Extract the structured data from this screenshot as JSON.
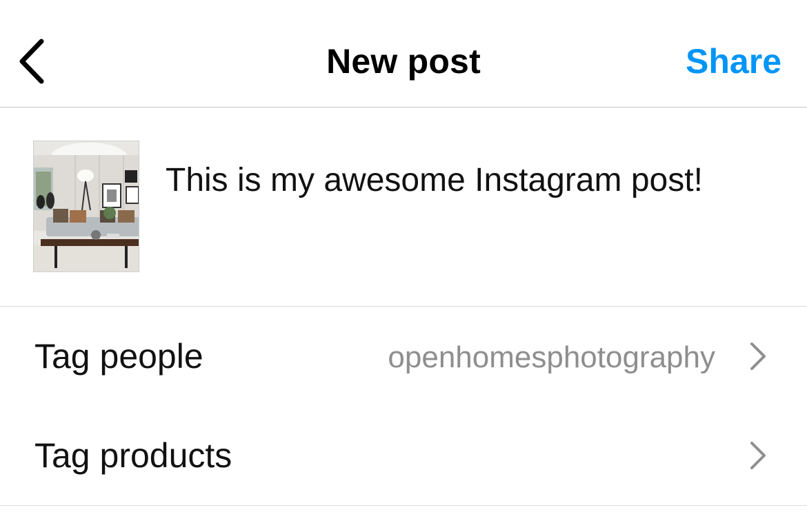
{
  "header": {
    "title": "New post",
    "share_label": "Share",
    "back_icon": "chevron-left-icon"
  },
  "composer": {
    "caption": "This is my awesome Instagram post!",
    "thumbnail": "living-room-photo"
  },
  "rows": [
    {
      "label": "Tag people",
      "value": "openhomesphotography",
      "icon": "chevron-right-icon"
    },
    {
      "label": "Tag products",
      "value": "",
      "icon": "chevron-right-icon"
    }
  ],
  "colors": {
    "accent": "#0095f6",
    "secondary_text": "#8e8e8e",
    "divider": "#dbdbdb"
  }
}
